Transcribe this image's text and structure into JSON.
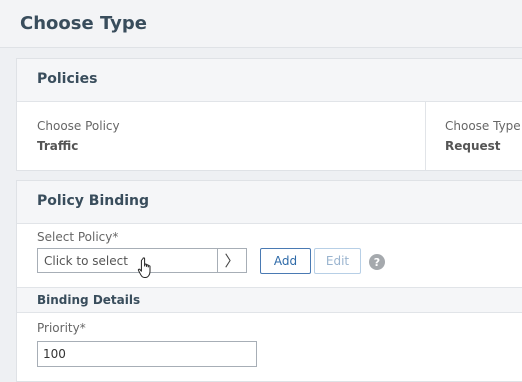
{
  "page": {
    "title": "Choose Type"
  },
  "policies": {
    "title": "Policies",
    "choose_policy_label": "Choose Policy",
    "choose_policy_value": "Traffic",
    "choose_type_label": "Choose Type",
    "choose_type_value": "Request"
  },
  "binding": {
    "title": "Policy Binding",
    "select_policy_label": "Select Policy*",
    "select_placeholder": "Click to select",
    "arrow_glyph": "〉",
    "add_label": "Add",
    "edit_label": "Edit",
    "help_glyph": "?",
    "details_title": "Binding Details",
    "priority_label": "Priority*",
    "priority_value": "100"
  },
  "icons": {
    "select_arrow": "chevron-right-icon",
    "help": "help-icon",
    "cursor": "hand-cursor-icon"
  },
  "colors": {
    "title": "#394d5c",
    "accent": "#2e6aa8",
    "disabled": "#9ab4cf"
  }
}
